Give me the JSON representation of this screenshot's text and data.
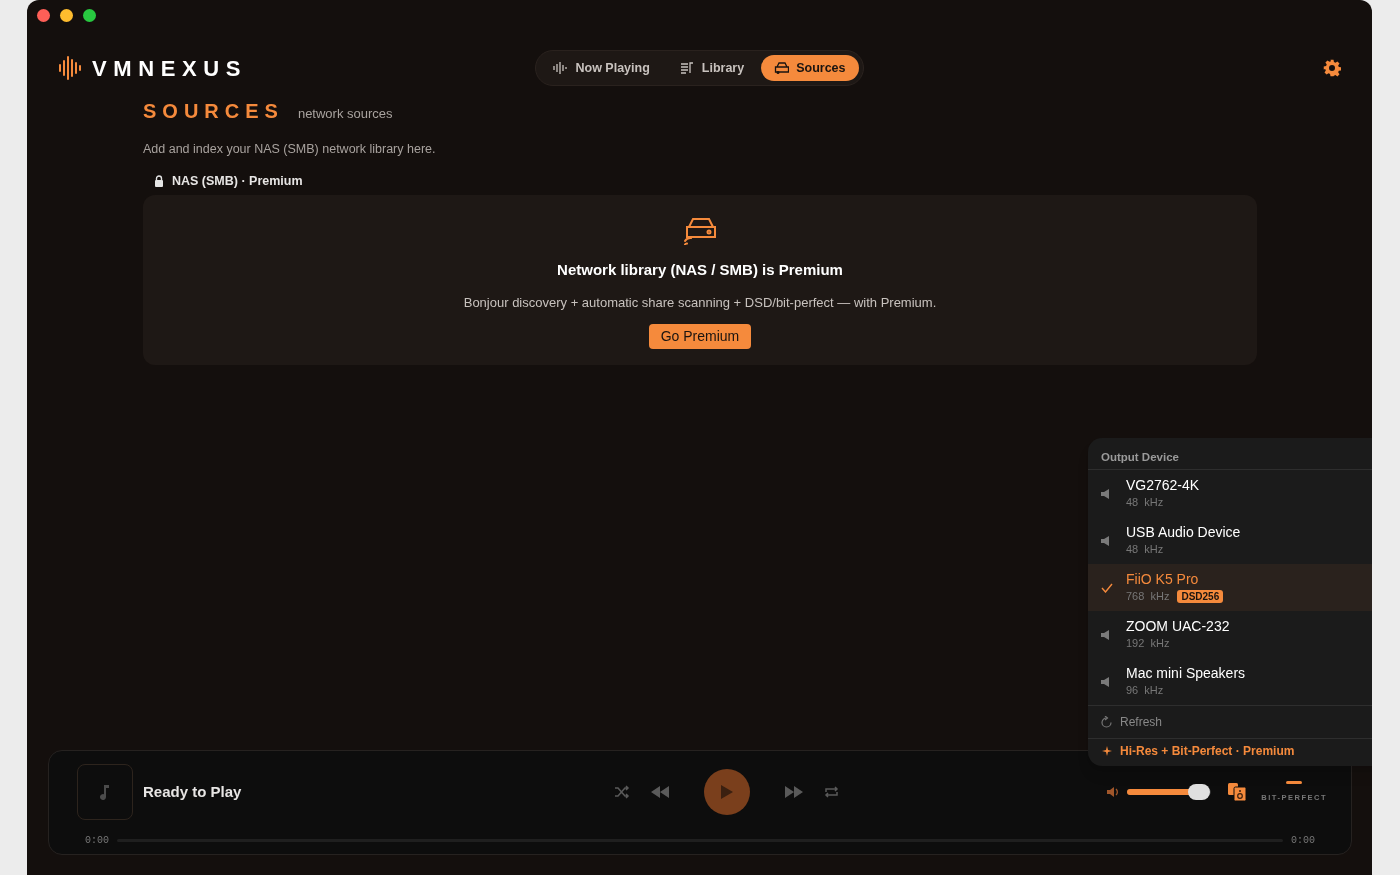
{
  "app": {
    "logo": "VMNEXUS"
  },
  "tabs": [
    {
      "label": "Now Playing",
      "kind": "wave",
      "selected": false
    },
    {
      "label": "Library",
      "kind": "list",
      "selected": false
    },
    {
      "label": "Sources",
      "kind": "drive",
      "selected": true
    }
  ],
  "page": {
    "title": "SOURCES",
    "subtitle": "network sources",
    "description": "Add and index your NAS (SMB) network library here.",
    "section": "NAS (SMB) · Premium",
    "card": {
      "title": "Network library (NAS / SMB) is Premium",
      "text": "Bonjour discovery + automatic share scanning + DSD/bit-perfect — with Premium.",
      "button": "Go Premium"
    }
  },
  "output_menu": {
    "title": "Output Device",
    "devices": [
      {
        "name": "VG2762-4K",
        "rate": "48  kHz",
        "selected": false
      },
      {
        "name": "USB Audio Device",
        "rate": "48  kHz",
        "selected": false
      },
      {
        "name": "FiiO K5 Pro",
        "rate": "768  kHz",
        "badge": "DSD256",
        "selected": true
      },
      {
        "name": "ZOOM UAC-232",
        "rate": "192  kHz",
        "selected": false
      },
      {
        "name": "Mac mini Speakers",
        "rate": "96  kHz",
        "selected": false
      }
    ],
    "refresh": "Refresh",
    "premium": "Hi-Res + Bit-Perfect · Premium"
  },
  "player": {
    "title": "Ready to Play",
    "elapsed": "0:00",
    "total": "0:00",
    "volume": {
      "level": 0.85
    },
    "bit_perfect": "BIT-PERFECT"
  }
}
